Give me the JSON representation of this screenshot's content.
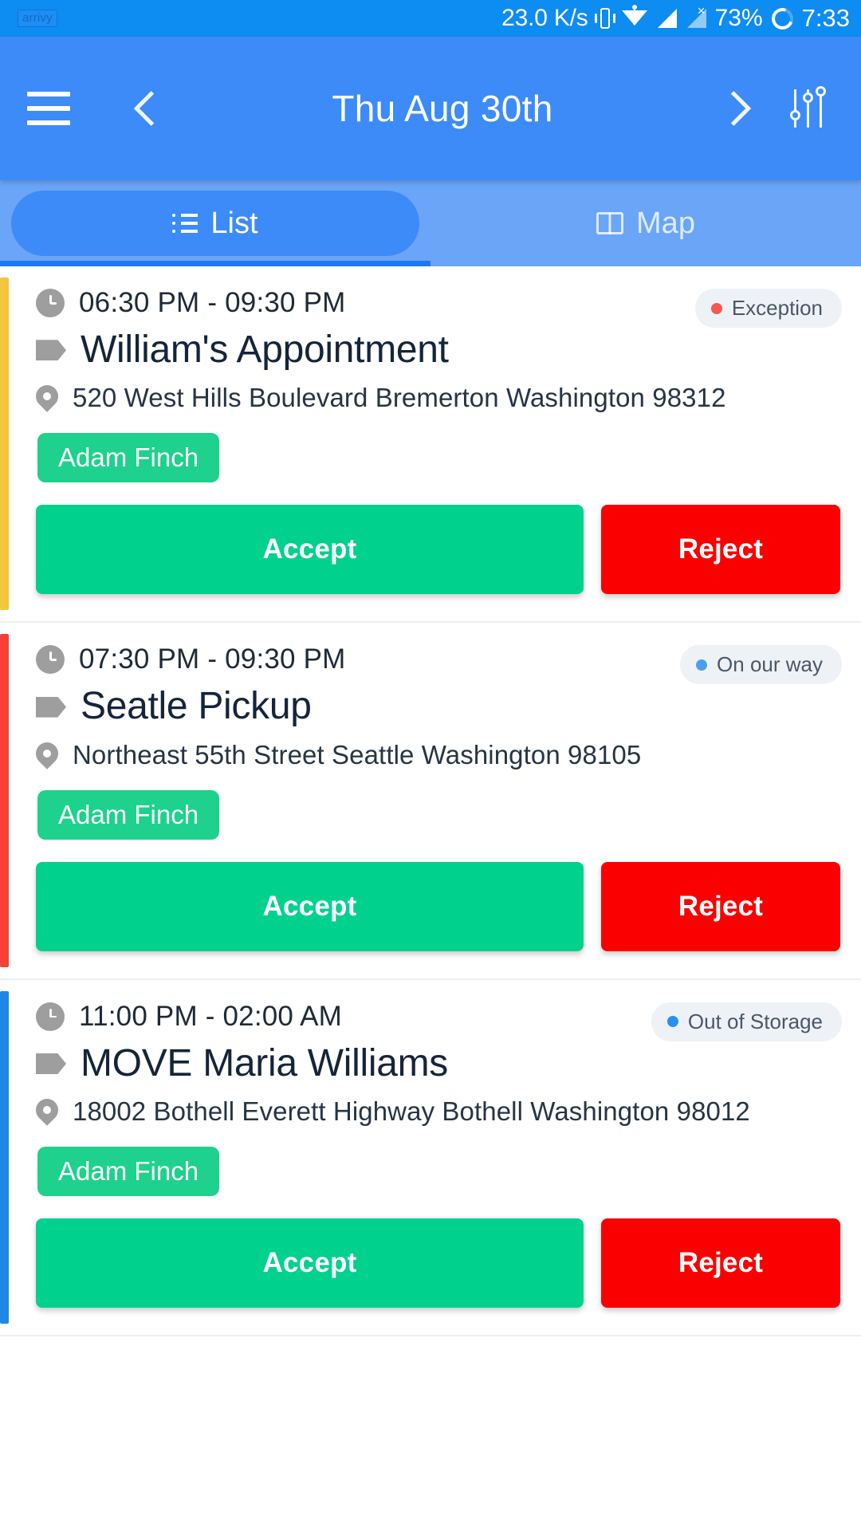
{
  "status_bar": {
    "notification_app": "arrivy",
    "network_speed": "23.0 K/s",
    "battery_percent": "73%",
    "clock": "7:33",
    "icons": [
      "vibrate-icon",
      "wifi-icon",
      "signal-icon",
      "signal-no-service-icon",
      "battery-icon"
    ]
  },
  "app_bar": {
    "menu_icon": "hamburger-menu-icon",
    "prev_icon": "chevron-left-icon",
    "title": "Thu Aug 30th",
    "next_icon": "chevron-right-icon",
    "filter_icon": "filter-sliders-icon"
  },
  "tabs": [
    {
      "label": "List",
      "icon": "list-icon",
      "active": true
    },
    {
      "label": "Map",
      "icon": "map-icon",
      "active": false
    }
  ],
  "colors": {
    "primary_blue": "#3d8bf8",
    "status_bar_blue": "#0d8cf2",
    "tab_strip_blue": "#6ba5f7",
    "accept_green": "#00d18d",
    "reject_red": "#fb0000",
    "assignee_green": "#1ed18c",
    "accent_yellow": "#f5c53d",
    "accent_red": "#f44336",
    "accent_blue": "#1e88e5",
    "badge_bg": "#eef2f6"
  },
  "buttons": {
    "accept_label": "Accept",
    "reject_label": "Reject"
  },
  "tasks": [
    {
      "time": "06:30 PM - 09:30 PM",
      "title": "William's Appointment",
      "address": "520 West Hills Boulevard Bremerton Washington 98312",
      "assignee": "Adam Finch",
      "status": "Exception",
      "status_dot_color": "#f4584f",
      "accent_color": "#f5c53d"
    },
    {
      "time": "07:30 PM - 09:30 PM",
      "title": "Seatle Pickup",
      "address": "Northeast 55th Street Seattle Washington 98105",
      "assignee": "Adam Finch",
      "status": "On our way",
      "status_dot_color": "#4e9df0",
      "accent_color": "#f44336"
    },
    {
      "time": "11:00 PM - 02:00 AM",
      "title": "MOVE Maria Williams",
      "address": "18002 Bothell Everett Highway Bothell Washington 98012",
      "assignee": "Adam Finch",
      "status": "Out of Storage",
      "status_dot_color": "#2b90ef",
      "accent_color": "#1e88e5"
    }
  ]
}
